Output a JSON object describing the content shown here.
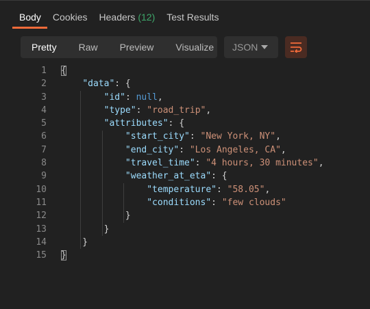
{
  "tabs": [
    {
      "label": "Body",
      "active": true
    },
    {
      "label": "Cookies"
    },
    {
      "label": "Headers",
      "count": "(12)"
    },
    {
      "label": "Test Results"
    }
  ],
  "view_modes": [
    "Pretty",
    "Raw",
    "Preview",
    "Visualize"
  ],
  "format_select": {
    "value": "JSON"
  },
  "wrap_icon": "wrap-lines-icon",
  "colors": {
    "accent": "#f26b3a",
    "count": "#3ea86b",
    "key": "#9cdcfe",
    "string": "#ce9178",
    "keyword": "#569cd6"
  },
  "code_lines": [
    {
      "n": "1",
      "tokens": [
        {
          "t": "pun",
          "v": "{"
        }
      ]
    },
    {
      "n": "2",
      "tokens": [
        {
          "t": "pun",
          "v": "    "
        },
        {
          "t": "key",
          "v": "\"data\""
        },
        {
          "t": "pun",
          "v": ": {"
        }
      ]
    },
    {
      "n": "3",
      "tokens": [
        {
          "t": "pun",
          "v": "        "
        },
        {
          "t": "key",
          "v": "\"id\""
        },
        {
          "t": "pun",
          "v": ": "
        },
        {
          "t": "kw",
          "v": "null"
        },
        {
          "t": "pun",
          "v": ","
        }
      ]
    },
    {
      "n": "4",
      "tokens": [
        {
          "t": "pun",
          "v": "        "
        },
        {
          "t": "key",
          "v": "\"type\""
        },
        {
          "t": "pun",
          "v": ": "
        },
        {
          "t": "str",
          "v": "\"road_trip\""
        },
        {
          "t": "pun",
          "v": ","
        }
      ]
    },
    {
      "n": "5",
      "tokens": [
        {
          "t": "pun",
          "v": "        "
        },
        {
          "t": "key",
          "v": "\"attributes\""
        },
        {
          "t": "pun",
          "v": ": {"
        }
      ]
    },
    {
      "n": "6",
      "tokens": [
        {
          "t": "pun",
          "v": "            "
        },
        {
          "t": "key",
          "v": "\"start_city\""
        },
        {
          "t": "pun",
          "v": ": "
        },
        {
          "t": "str",
          "v": "\"New York, NY\""
        },
        {
          "t": "pun",
          "v": ","
        }
      ]
    },
    {
      "n": "7",
      "tokens": [
        {
          "t": "pun",
          "v": "            "
        },
        {
          "t": "key",
          "v": "\"end_city\""
        },
        {
          "t": "pun",
          "v": ": "
        },
        {
          "t": "str",
          "v": "\"Los Angeles, CA\""
        },
        {
          "t": "pun",
          "v": ","
        }
      ]
    },
    {
      "n": "8",
      "tokens": [
        {
          "t": "pun",
          "v": "            "
        },
        {
          "t": "key",
          "v": "\"travel_time\""
        },
        {
          "t": "pun",
          "v": ": "
        },
        {
          "t": "str",
          "v": "\"4 hours, 30 minutes\""
        },
        {
          "t": "pun",
          "v": ","
        }
      ]
    },
    {
      "n": "9",
      "tokens": [
        {
          "t": "pun",
          "v": "            "
        },
        {
          "t": "key",
          "v": "\"weather_at_eta\""
        },
        {
          "t": "pun",
          "v": ": {"
        }
      ]
    },
    {
      "n": "10",
      "tokens": [
        {
          "t": "pun",
          "v": "                "
        },
        {
          "t": "key",
          "v": "\"temperature\""
        },
        {
          "t": "pun",
          "v": ": "
        },
        {
          "t": "str",
          "v": "\"58.05\""
        },
        {
          "t": "pun",
          "v": ","
        }
      ]
    },
    {
      "n": "11",
      "tokens": [
        {
          "t": "pun",
          "v": "                "
        },
        {
          "t": "key",
          "v": "\"conditions\""
        },
        {
          "t": "pun",
          "v": ": "
        },
        {
          "t": "str",
          "v": "\"few clouds\""
        }
      ]
    },
    {
      "n": "12",
      "tokens": [
        {
          "t": "pun",
          "v": "            }"
        }
      ]
    },
    {
      "n": "13",
      "tokens": [
        {
          "t": "pun",
          "v": "        }"
        }
      ]
    },
    {
      "n": "14",
      "tokens": [
        {
          "t": "pun",
          "v": "    }"
        }
      ]
    },
    {
      "n": "15",
      "tokens": [
        {
          "t": "pun",
          "v": "}"
        }
      ]
    }
  ]
}
